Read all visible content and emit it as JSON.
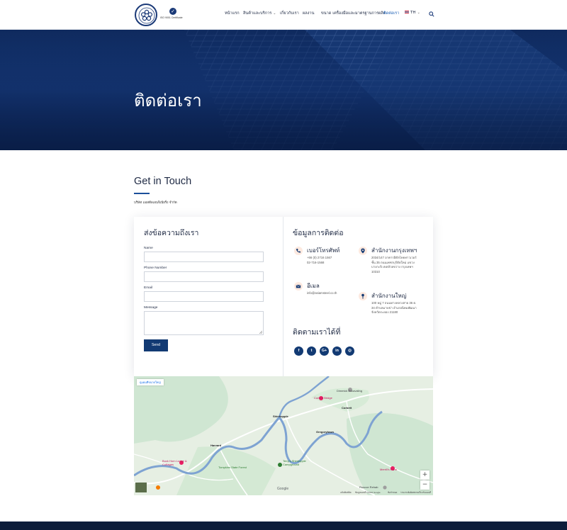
{
  "header": {
    "iso_text": "ISO 9001 Certificate",
    "nav": [
      {
        "label": "หน้าแรก"
      },
      {
        "label": "สินค้าและบริการ"
      },
      {
        "label": "เกี่ยวกับเรา"
      },
      {
        "label": "ผลงาน"
      },
      {
        "label": "ขนาด เครื่องมือและมาตรฐานการผลิต"
      },
      {
        "label": "ติดต่อเรา"
      },
      {
        "label": "TH"
      }
    ]
  },
  "hero": {
    "title": "ติดต่อเรา"
  },
  "intro": {
    "title": "Get in Touch",
    "subtitle": "บริษัท แอสตีลเอนจิเนียริ่ง จำกัด"
  },
  "form": {
    "title": "ส่งข้อความถึงเรา",
    "fields": [
      {
        "label": "Name"
      },
      {
        "label": "Phone Number"
      },
      {
        "label": "Email"
      },
      {
        "label": "Message"
      }
    ],
    "submit": "Send"
  },
  "contact": {
    "title": "ข้อมูลการติดต่อ",
    "phone_title": "เบอร์โทรศัพท์",
    "phone_1": "+66 (0) 2716 1567",
    "phone_2": "02-716-1568",
    "email_title": "อีเมล",
    "email": "info@asiamsteel.co.th",
    "bkk_title": "สำนักงานกรุงเทพฯ",
    "bkk_1": "2034/147 อาคารอิตัลไทยทาวเวอร์",
    "bkk_2": "ชั้น 35 ถนนเพชรบุรีตัดใหม่ แขวง",
    "bkk_3": "บางกะปิ เขตห้วยขวาง กรุงเทพฯ",
    "bkk_4": "10310",
    "hq_title": "สำนักงานใหญ่",
    "hq_1": "100 หมู่ 7 ถนนทางหลวงสาย 36 ต.",
    "hq_2": "34 ตำบลมาบข่า อำเภอนิคมพัฒนา",
    "hq_3": "จังหวัดระยอง 21180",
    "follow_title": "ติดตามเราได้ที่",
    "social": [
      {
        "icon": "facebook-icon",
        "glyph": "f"
      },
      {
        "icon": "twitter-icon",
        "glyph": "t"
      },
      {
        "icon": "google-plus-icon",
        "glyph": "G+"
      },
      {
        "icon": "linkedin-icon",
        "glyph": "in"
      },
      {
        "icon": "instagram-icon",
        "glyph": "◎"
      }
    ]
  },
  "map": {
    "view_larger": "ดูแผนที่ขนาดใหญ่",
    "labels": {
      "dimmick": "Dimmick Excavating",
      "corbett_bridge": "Corbett Bridge",
      "corbett": "Corbett",
      "shinhopple": "Shinhopple",
      "gregorytown": "Gregorytown",
      "harvard": "Harvard",
      "buck_horn": "Buck Horn Lodge & Cottages",
      "tompkins": "Tompkins State Forest",
      "terry": "Terry's Shinhopple Campground",
      "merrills": "Merrill's Farm",
      "roscoe": "Roscoe Rehab"
    },
    "google": "Google",
    "footer_1": "แป้นพิมพ์ลัด",
    "footer_2": "ข้อมูลแผนที่ ©2022 Google",
    "footer_3": "ข้อกำหนด",
    "footer_4": "รายงานข้อผิดพลาดเกี่ยวกับแผนที่"
  },
  "colors": {
    "primary": "#123a73",
    "accent": "#1b5fb5",
    "icon_bg": "#fde9df",
    "hero": "#163a7c"
  }
}
